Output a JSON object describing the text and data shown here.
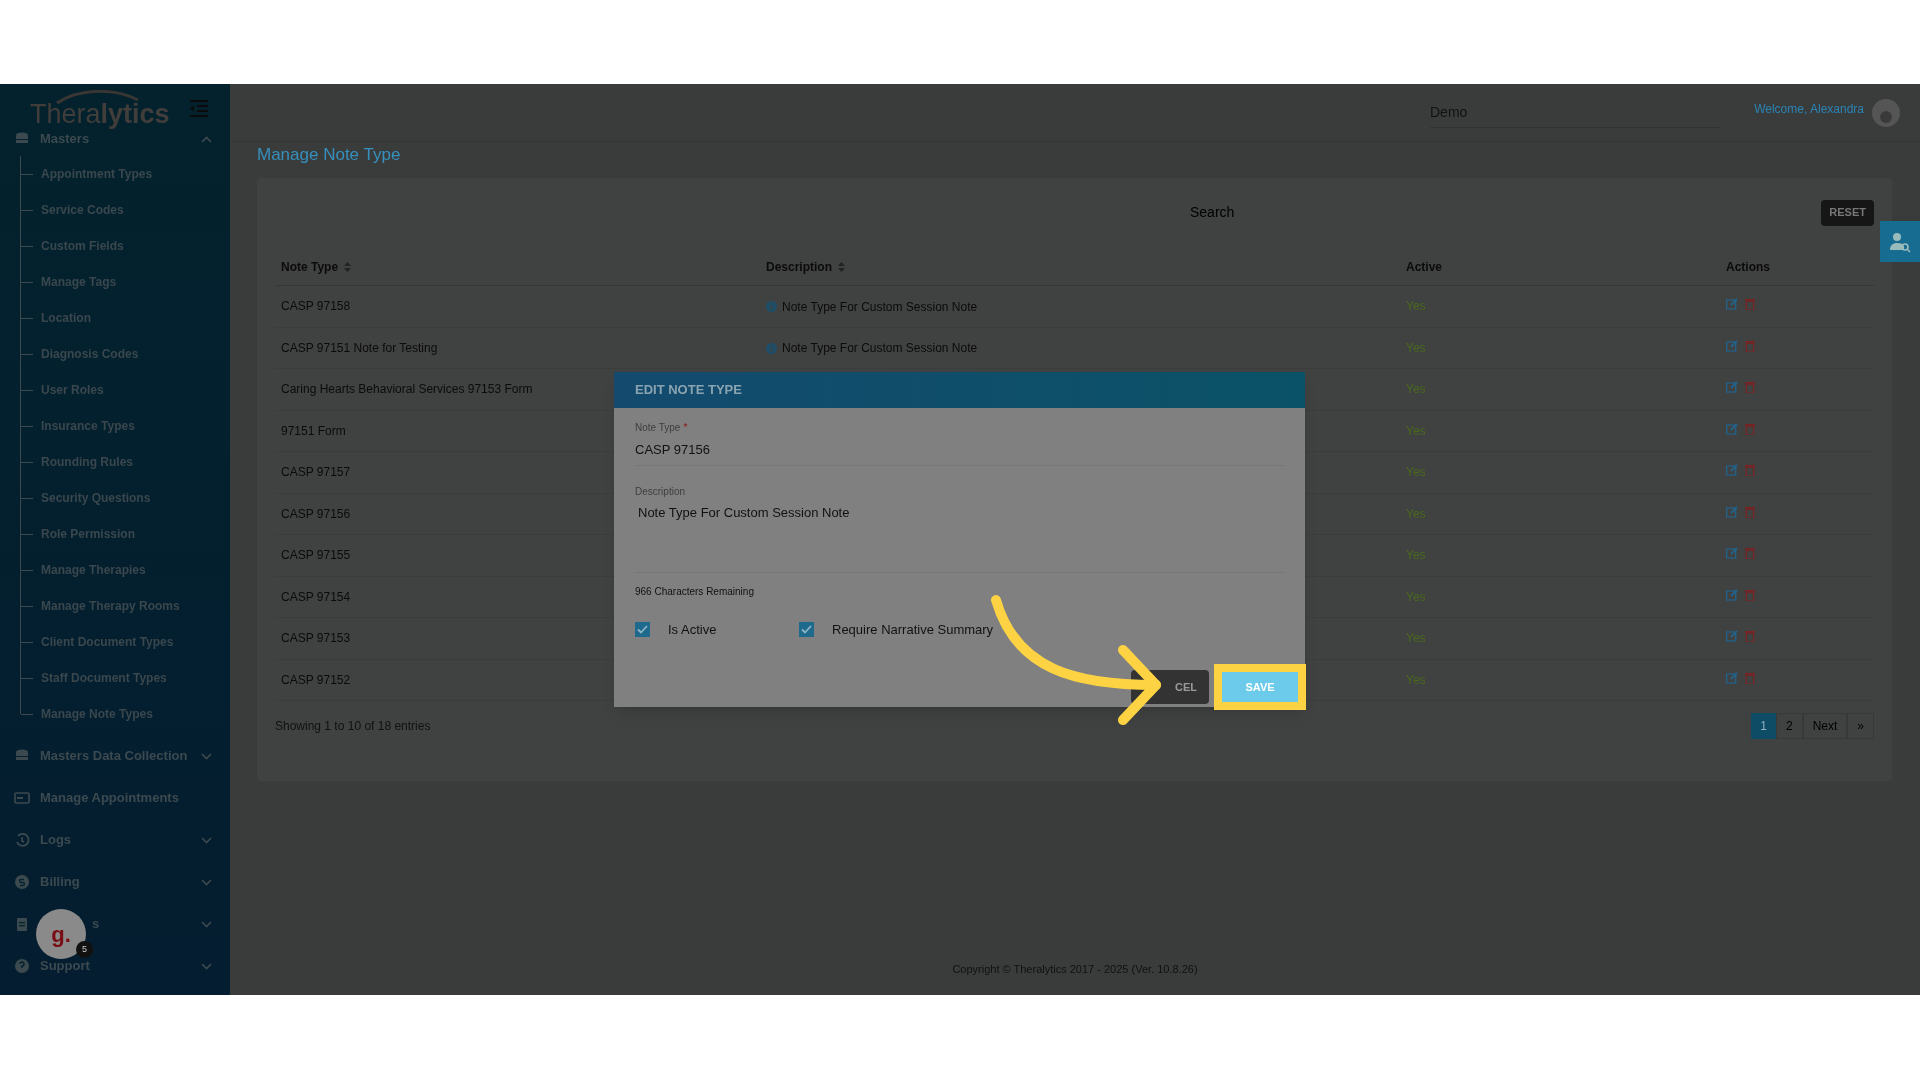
{
  "logo": "Thera**lytics**",
  "sidebar": {
    "items": [
      {
        "label": "Masters",
        "kind": "group",
        "expanded": true,
        "children": [
          {
            "label": "Appointment Types"
          },
          {
            "label": "Service Codes"
          },
          {
            "label": "Custom Fields"
          },
          {
            "label": "Manage Tags"
          },
          {
            "label": "Location"
          },
          {
            "label": "Diagnosis Codes"
          },
          {
            "label": "User Roles"
          },
          {
            "label": "Insurance Types"
          },
          {
            "label": "Rounding Rules"
          },
          {
            "label": "Security Questions"
          },
          {
            "label": "Role Permission"
          },
          {
            "label": "Manage Therapies"
          },
          {
            "label": "Manage Therapy Rooms"
          },
          {
            "label": "Client Document Types"
          },
          {
            "label": "Staff Document Types"
          },
          {
            "label": "Manage Note Types"
          }
        ]
      },
      {
        "label": "Masters Data Collection",
        "kind": "group",
        "expanded": false
      },
      {
        "label": "Manage Appointments",
        "kind": "link"
      },
      {
        "label": "Logs",
        "kind": "group",
        "expanded": false
      },
      {
        "label": "Billing",
        "kind": "group",
        "expanded": false
      },
      {
        "label": "s",
        "kind": "group",
        "expanded": false
      },
      {
        "label": "Support",
        "kind": "group",
        "expanded": false
      }
    ]
  },
  "header": {
    "company": "Demo",
    "welcome": "Welcome, Alexandra"
  },
  "page_title": "Manage Note Type",
  "search": {
    "placeholder": "Search"
  },
  "reset_button": "RESET",
  "table": {
    "columns": [
      {
        "label": "Note Type",
        "sortable": true
      },
      {
        "label": "Description",
        "sortable": true
      },
      {
        "label": "Active",
        "sortable": false
      },
      {
        "label": "Actions",
        "sortable": false
      }
    ],
    "rows": [
      {
        "note_type": "CASP 97158",
        "description": "Note Type For Custom Session Note",
        "active": "Yes"
      },
      {
        "note_type": "CASP 97151 Note for Testing",
        "description": "Note Type For Custom Session Note",
        "active": "Yes"
      },
      {
        "note_type": "Caring Hearts Behavioral Services 97153 Form",
        "active": "Yes"
      },
      {
        "note_type": "97151 Form",
        "active": "Yes"
      },
      {
        "note_type": "CASP 97157",
        "active": "Yes"
      },
      {
        "note_type": "CASP 97156",
        "active": "Yes"
      },
      {
        "note_type": "CASP 97155",
        "active": "Yes"
      },
      {
        "note_type": "CASP 97154",
        "active": "Yes"
      },
      {
        "note_type": "CASP 97153",
        "active": "Yes"
      },
      {
        "note_type": "CASP 97152",
        "active": "Yes"
      }
    ]
  },
  "pagination": {
    "info": "Showing 1 to 10 of 18 entries",
    "pages": [
      {
        "label": "1",
        "selected": true
      },
      {
        "label": "2",
        "selected": false
      },
      {
        "label": "Next",
        "selected": false
      },
      {
        "label": "»",
        "selected": false
      }
    ]
  },
  "footer": "Copyright © Theralytics 2017 - 2025 (Ver. 10.8.26)",
  "modal": {
    "title": "EDIT NOTE TYPE",
    "note_type": {
      "label": "Note Type",
      "required_mark": "*",
      "value": "CASP 97156"
    },
    "description": {
      "label": "Description",
      "value": "Note Type For Custom Session Note"
    },
    "chars_remaining": "966 Characters Remaining",
    "checkboxes": [
      {
        "label": "Is Active",
        "checked": true
      },
      {
        "label": "Require Narrative Summary",
        "checked": true
      }
    ],
    "cancel_button": "CEL",
    "save_button": {
      "label": "SAVE",
      "highlighted": true
    }
  },
  "chat_badge": {
    "letter": "g.",
    "count": "5"
  }
}
